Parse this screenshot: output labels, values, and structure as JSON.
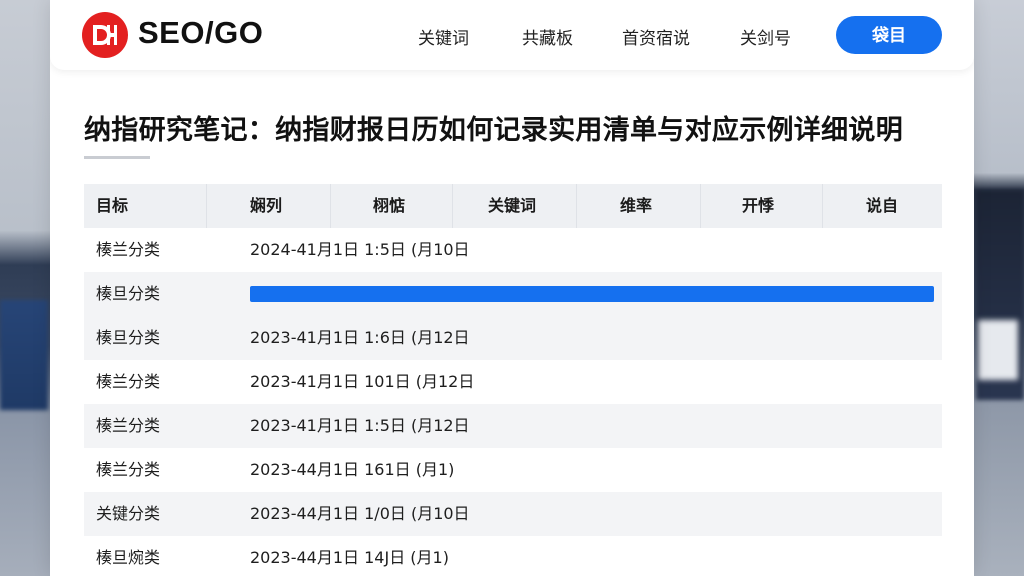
{
  "header": {
    "brand": "SEO/GO",
    "nav": [
      "关键词",
      "共藏板",
      "首资宿说",
      "关剑号"
    ],
    "login_label": "袋目"
  },
  "page": {
    "title": "纳指研究笔记：纳指财报日历如何记录实用清单与对应示例详细说明"
  },
  "table": {
    "headers": [
      "目标",
      "娴列",
      "栩惦",
      "关键词",
      "维率",
      "开悸",
      "说自"
    ],
    "rows": [
      {
        "name": "楱兰分类",
        "date": "2024-41月1日 1:5日 (月10日"
      },
      {
        "name": "楱旦分类",
        "progress": 1.0
      },
      {
        "name": "楱旦分类",
        "date": "2023-41月1日 1:6日 (月12日"
      },
      {
        "name": "楱兰分类",
        "date": "2023-41月1日 101日 (月12日"
      },
      {
        "name": "楱兰分类",
        "date": "2023-41月1日 1:5日 (月12日"
      },
      {
        "name": "楱兰分类",
        "date": "2023-44月1日 161日 (月1)"
      },
      {
        "name": "关键分类",
        "date": "2023-44月1日 1/0日 (月10日"
      },
      {
        "name": "楱旦焥类",
        "date": "2023-44月1日 14J日 (月1)"
      }
    ]
  },
  "colors": {
    "accent": "#1570ef",
    "logo": "#e32020"
  }
}
